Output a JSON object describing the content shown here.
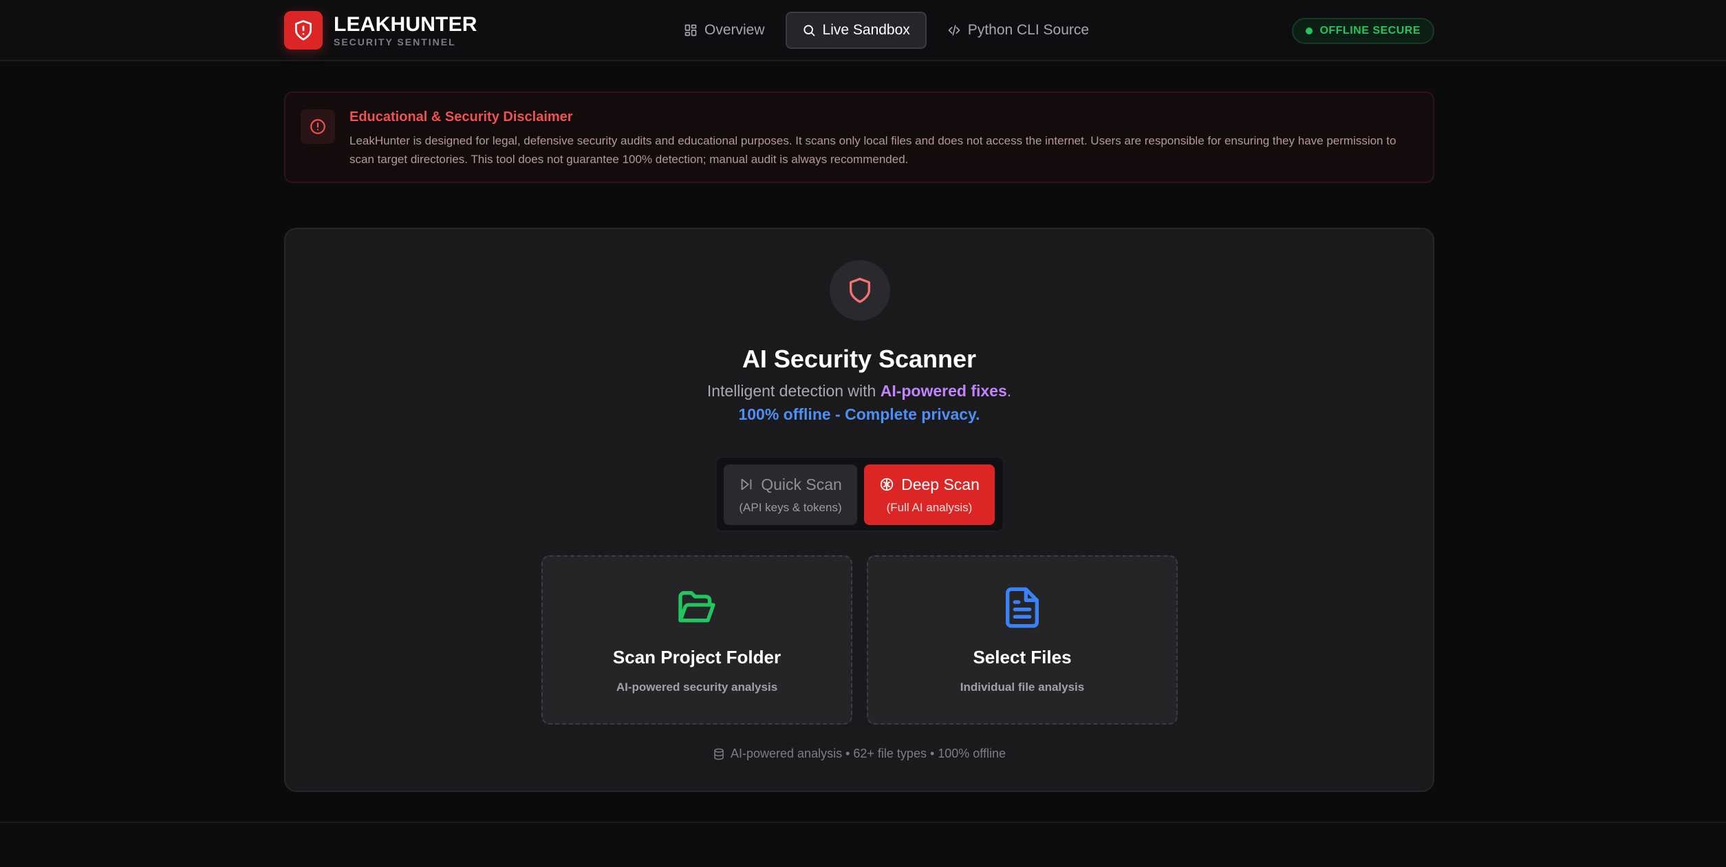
{
  "header": {
    "brand_name": "LEAKHUNTER",
    "brand_subtitle": "SECURITY SENTINEL",
    "logo_icon": "shield-alert-icon",
    "nav": [
      {
        "label": "Overview",
        "icon": "dashboard-grid-icon",
        "active": false
      },
      {
        "label": "Live Sandbox",
        "icon": "search-icon",
        "active": true
      },
      {
        "label": "Python CLI Source",
        "icon": "code-icon",
        "active": false
      }
    ],
    "status": "OFFLINE SECURE"
  },
  "disclaimer": {
    "title": "Educational & Security Disclaimer",
    "body": "LeakHunter is designed for legal, defensive security audits and educational purposes. It scans only local files and does not access the internet. Users are responsible for ensuring they have permission to scan target directories. This tool does not guarantee 100% detection; manual audit is always recommended."
  },
  "scanner": {
    "title": "AI Security Scanner",
    "tagline_prefix": "Intelligent detection with ",
    "tagline_highlight": "AI-powered fixes",
    "tagline_suffix": ".",
    "privacy_line": "100% offline - Complete privacy.",
    "modes": {
      "quick": {
        "label": "Quick Scan",
        "sub": "(API keys & tokens)",
        "selected": false
      },
      "deep": {
        "label": "Deep Scan",
        "sub": "(Full AI analysis)",
        "selected": true
      }
    },
    "cards": {
      "folder": {
        "title": "Scan Project Folder",
        "sub": "AI-powered security analysis"
      },
      "files": {
        "title": "Select Files",
        "sub": "Individual file analysis"
      }
    },
    "footer_note": "AI-powered analysis • 62+ file types • 100% offline"
  },
  "colors": {
    "accent_red": "#dc2626",
    "status_green": "#22c55e",
    "highlight_purple": "#c084fc",
    "privacy_blue": "#4d8ef7",
    "folder_green": "#22c55e",
    "file_blue": "#3b82f6"
  }
}
